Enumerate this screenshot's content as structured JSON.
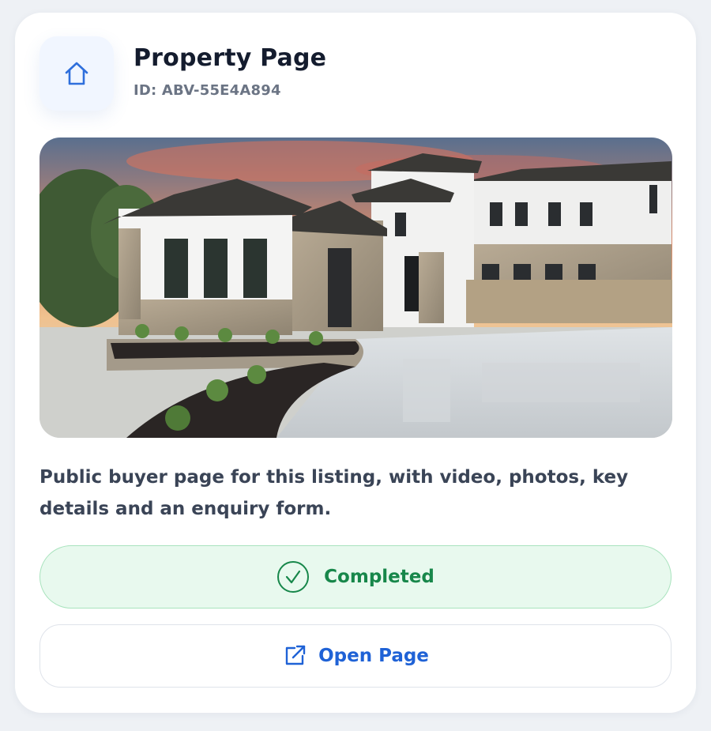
{
  "card": {
    "title": "Property Page",
    "id_label": "ID: ABV-55E4A894",
    "header_icon": "home-icon",
    "description": "Public buyer page for this listing, with video, photos, key details and an enquiry form.",
    "status": {
      "label": "Completed",
      "icon": "check-circle-icon",
      "color": "#17874a"
    },
    "action": {
      "label": "Open Page",
      "icon": "external-link-icon",
      "color": "#1f62d6"
    }
  }
}
